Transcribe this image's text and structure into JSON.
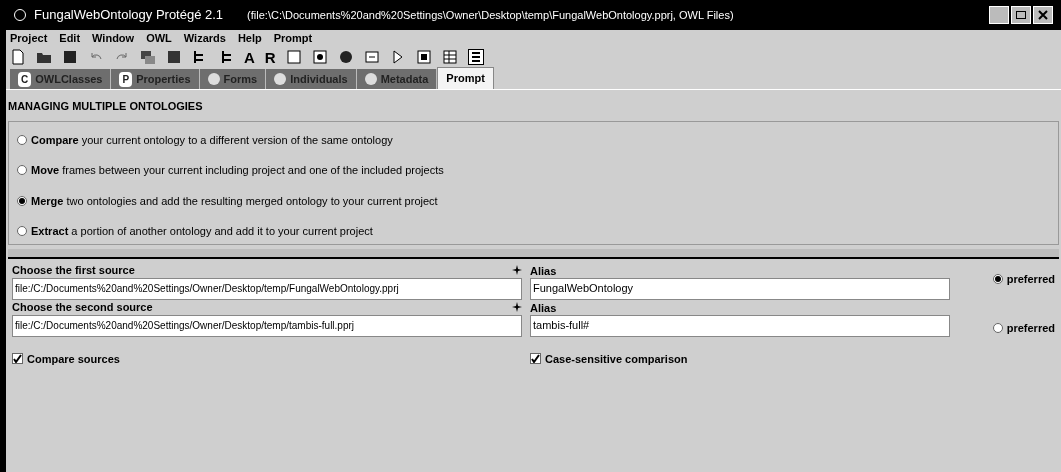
{
  "window": {
    "title": "FungalWebOntology  Protégé 2.1",
    "path": "(file:\\C:\\Documents%20and%20Settings\\Owner\\Desktop\\temp\\FungalWebOntology.pprj, OWL Files)"
  },
  "menu": [
    "Project",
    "Edit",
    "Window",
    "OWL",
    "Wizards",
    "Help",
    "Prompt"
  ],
  "toolbar_letters": [
    "A",
    "R"
  ],
  "tabs": [
    {
      "label": "OWLClasses",
      "badge": "C",
      "selected": false
    },
    {
      "label": "Properties",
      "badge": "P",
      "selected": false
    },
    {
      "label": "Forms",
      "selected": false
    },
    {
      "label": "Individuals",
      "selected": false
    },
    {
      "label": "Metadata",
      "selected": false
    },
    {
      "label": "Prompt",
      "selected": true
    }
  ],
  "section_title": "MANAGING MULTIPLE ONTOLOGIES",
  "options": [
    {
      "bold": "Compare",
      "rest": " your current ontology to a different version of the same ontology",
      "selected": false
    },
    {
      "bold": "Move",
      "rest": " frames between your current including project and one of the included projects",
      "selected": false
    },
    {
      "bold": "Merge",
      "rest": " two ontologies and add the resulting merged ontology to your current project",
      "selected": true
    },
    {
      "bold": "Extract",
      "rest": " a portion of another ontology and add it to your current project",
      "selected": false
    }
  ],
  "sources": [
    {
      "label": "Choose the first source",
      "path": "file:/C:/Documents%20and%20Settings/Owner/Desktop/temp/FungalWebOntology.pprj",
      "alias_label": "Alias",
      "alias": "FungalWebOntology",
      "preferred_label": "preferred",
      "preferred": true
    },
    {
      "label": "Choose the second source",
      "path": "file:/C:/Documents%20and%20Settings/Owner/Desktop/temp/tambis-full.pprj",
      "alias_label": "Alias",
      "alias": "tambis-full#",
      "preferred_label": "preferred",
      "preferred": false
    }
  ],
  "checkboxes": [
    {
      "label": "Compare sources",
      "checked": true
    },
    {
      "label": "Case-sensitive comparison",
      "checked": true
    }
  ]
}
